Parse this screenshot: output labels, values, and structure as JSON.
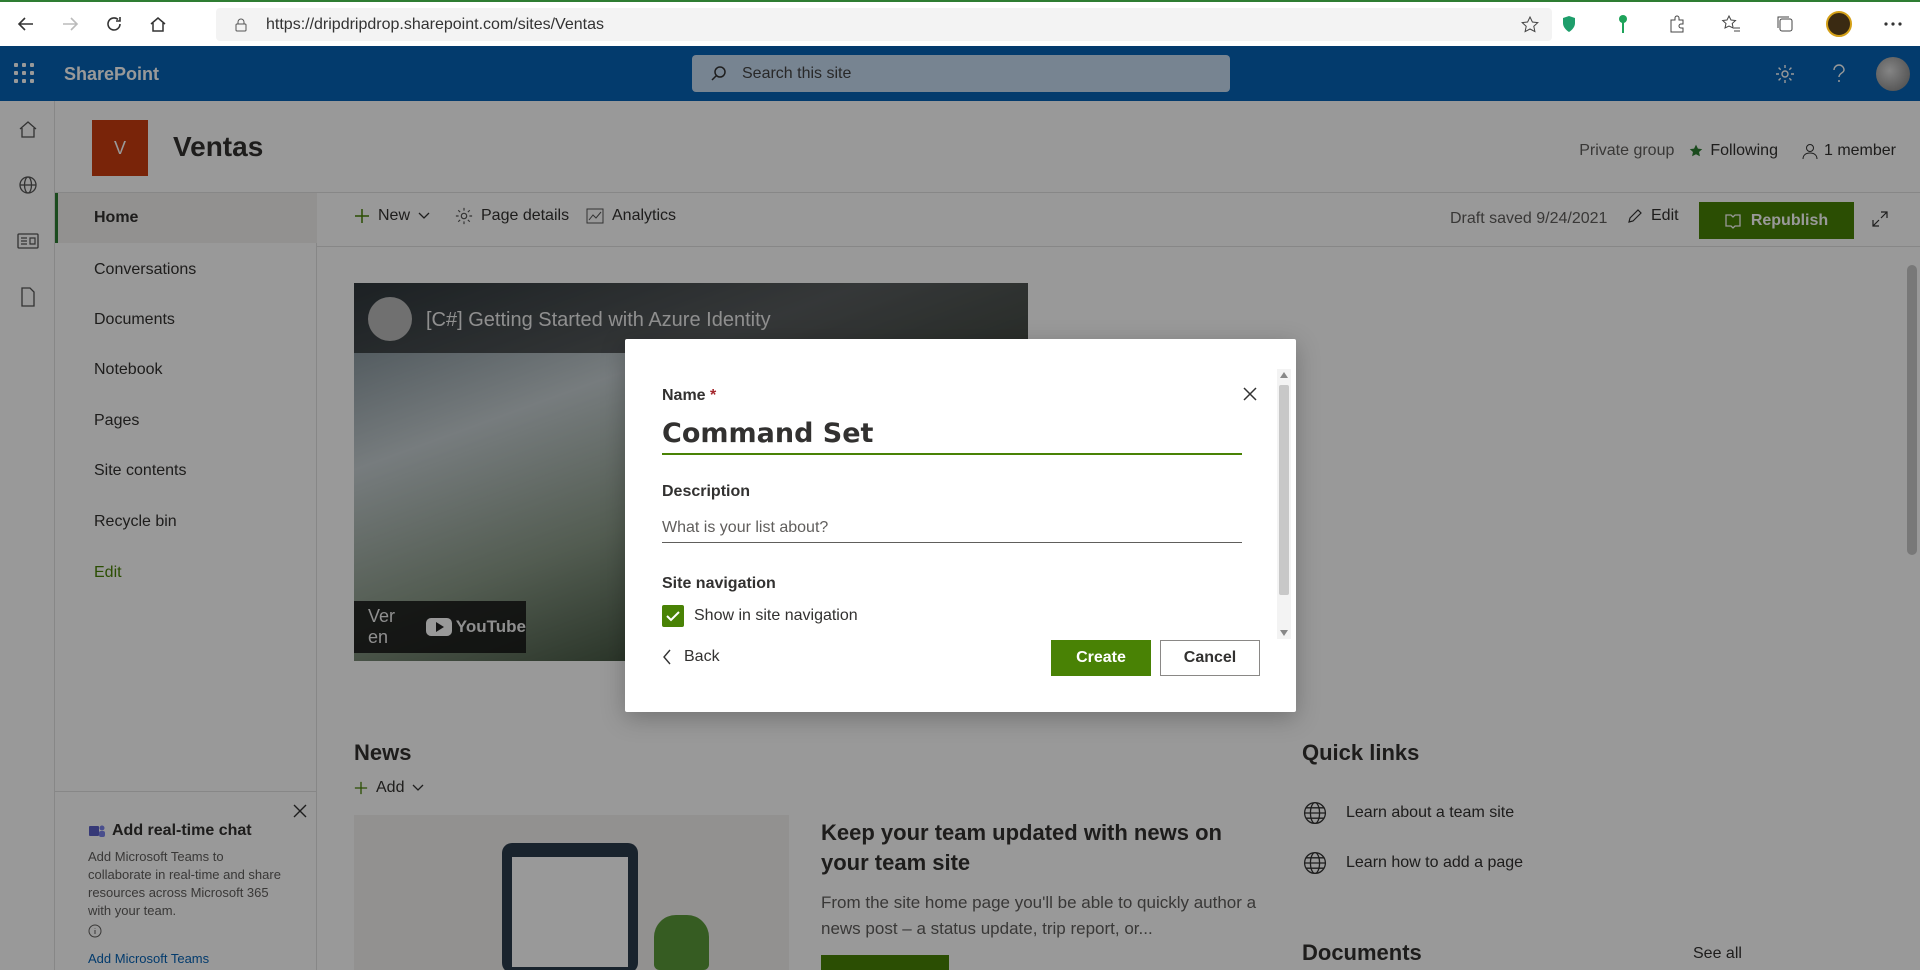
{
  "browser": {
    "url": "https://dripdripdrop.sharepoint.com/sites/Ventas"
  },
  "suitebar": {
    "brand": "SharePoint",
    "search_placeholder": "Search this site"
  },
  "site": {
    "logo_letter": "V",
    "title": "Ventas",
    "privacy": "Private group",
    "following": "Following",
    "members": "1 member"
  },
  "nav": {
    "items": [
      {
        "label": "Home"
      },
      {
        "label": "Conversations"
      },
      {
        "label": "Documents"
      },
      {
        "label": "Notebook"
      },
      {
        "label": "Pages"
      },
      {
        "label": "Site contents"
      },
      {
        "label": "Recycle bin"
      },
      {
        "label": "Edit"
      }
    ]
  },
  "chat_card": {
    "title": "Add real-time chat",
    "body": "Add Microsoft Teams to collaborate in real-time and share resources across Microsoft 365 with your team.",
    "link": "Add Microsoft Teams"
  },
  "cmdbar": {
    "new": "New",
    "page_details": "Page details",
    "analytics": "Analytics",
    "draft": "Draft saved 9/24/2021",
    "edit": "Edit",
    "republish": "Republish"
  },
  "video": {
    "title": "[C#] Getting Started with Azure Identity",
    "watch_on": "Ver en",
    "yt": "YouTube"
  },
  "news": {
    "title": "News",
    "add": "Add",
    "headline": "Keep your team updated with news on your team site",
    "body": "From the site home page you'll be able to quickly author a news post – a status update, trip report, or..."
  },
  "quick_links": {
    "title": "Quick links",
    "items": [
      {
        "label": "Learn about a team site"
      },
      {
        "label": "Learn how to add a page"
      }
    ]
  },
  "documents": {
    "title": "Documents",
    "see_all": "See all"
  },
  "dialog": {
    "name_label": "Name",
    "required_mark": "*",
    "name_value": "Command Set",
    "description_label": "Description",
    "description_placeholder": "What is your list about?",
    "site_nav_label": "Site navigation",
    "show_in_nav_label": "Show in site navigation",
    "show_in_nav_checked": true,
    "back": "Back",
    "create": "Create",
    "cancel": "Cancel"
  },
  "colors": {
    "suitebar": "#0563b6",
    "accent_green": "#498205",
    "site_logo": "#ca3c0f"
  }
}
